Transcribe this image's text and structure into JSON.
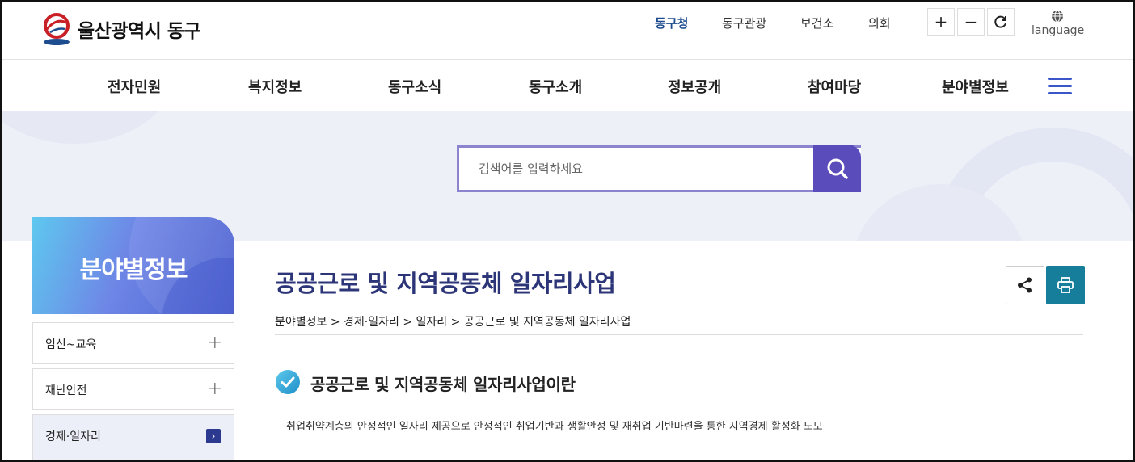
{
  "site": {
    "name": "울산광역시 동구"
  },
  "utility_links": [
    {
      "label": "동구청",
      "active": true
    },
    {
      "label": "동구관광",
      "active": false
    },
    {
      "label": "보건소",
      "active": false
    },
    {
      "label": "의회",
      "active": false
    }
  ],
  "zoom": {
    "in": "+",
    "out": "−",
    "reset_icon": "refresh-icon"
  },
  "language": {
    "label": "language",
    "icon": "globe-icon"
  },
  "gnb": [
    "전자민원",
    "복지정보",
    "동구소식",
    "동구소개",
    "정보공개",
    "참여마당",
    "분야별정보"
  ],
  "search": {
    "placeholder": "검색어를 입력하세요",
    "button_icon": "search-icon"
  },
  "sidebar": {
    "title": "분야별정보",
    "items": [
      {
        "label": "임신~교육",
        "icon": "plus-icon"
      },
      {
        "label": "재난안전",
        "icon": "plus-icon"
      },
      {
        "label": "경제·일자리",
        "icon": "chevron-right-icon",
        "active": true
      }
    ]
  },
  "main": {
    "title": "공공근로 및 지역공동체 일자리사업",
    "breadcrumb": "분야별정보 > 경제·일자리 > 일자리 > 공공근로 및 지역공동체 일자리사업",
    "section_title": "공공근로 및 지역공동체 일자리사업이란",
    "description": "취업취약계층의 안정적인 일자리 제공으로 안정적인 취업기반과 생활안정 및 재취업 기반마련을 통한 지역경제 활성화 도모"
  },
  "colors": {
    "brand": "#2c3578",
    "search_button": "#5a4cba",
    "print_button": "#167e9a",
    "accent": "#3a56c8"
  }
}
